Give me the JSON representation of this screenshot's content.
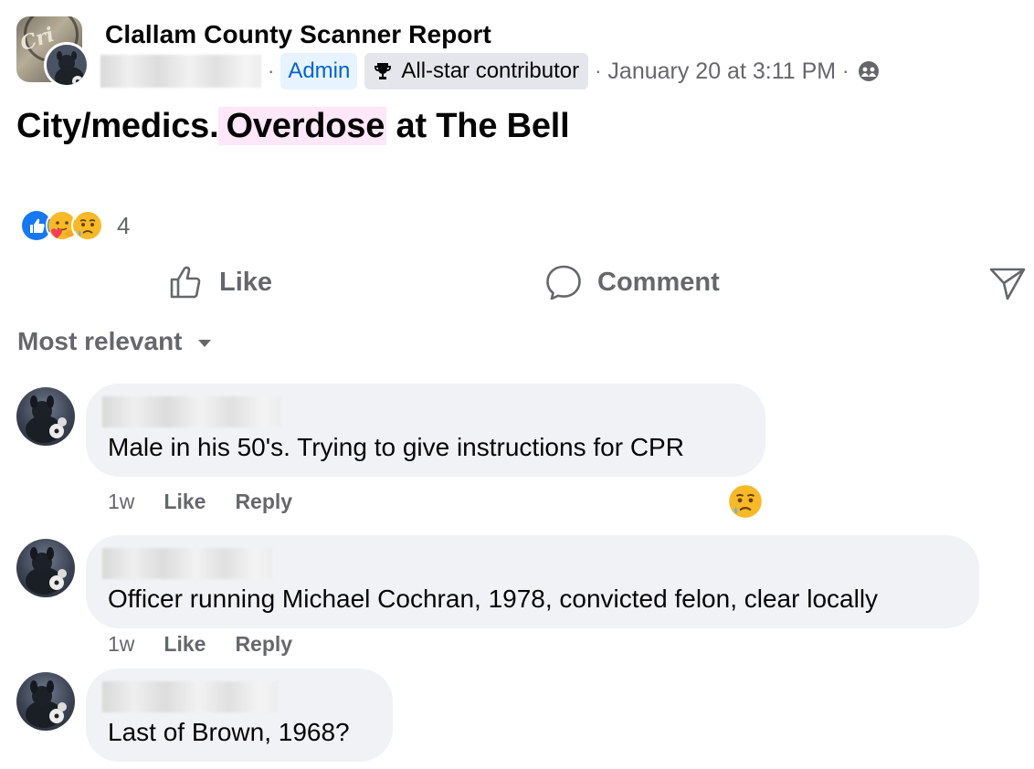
{
  "post": {
    "group_name": "Clallam County Scanner Report",
    "separator": "·",
    "admin_badge": "Admin",
    "contributor_badge": "All-star contributor",
    "date": "January 20 at 3:11 PM",
    "date_separator": "·",
    "text_before": "City/medics.",
    "text_highlight": "Overdose",
    "text_after": "at The Bell",
    "highlight_color": "#fde7f8"
  },
  "reactions": {
    "icons": [
      "like-icon",
      "care-icon",
      "sad-icon"
    ],
    "count": "4"
  },
  "actions": {
    "like": "Like",
    "comment": "Comment"
  },
  "sort": {
    "label": "Most relevant"
  },
  "comments": [
    {
      "text": "Male in his 50's. Trying to give instructions for CPR",
      "time": "1w",
      "like": "Like",
      "reply": "Reply",
      "reaction": "sad-icon"
    },
    {
      "text": "Officer running Michael Cochran, 1978, convicted felon, clear locally",
      "time": "1w",
      "like": "Like",
      "reply": "Reply"
    },
    {
      "text": "Last of Brown, 1968?"
    }
  ],
  "colors": {
    "accent_blue": "#0064d1",
    "secondary_text": "#65676b",
    "bubble_bg": "#f0f2f5"
  }
}
